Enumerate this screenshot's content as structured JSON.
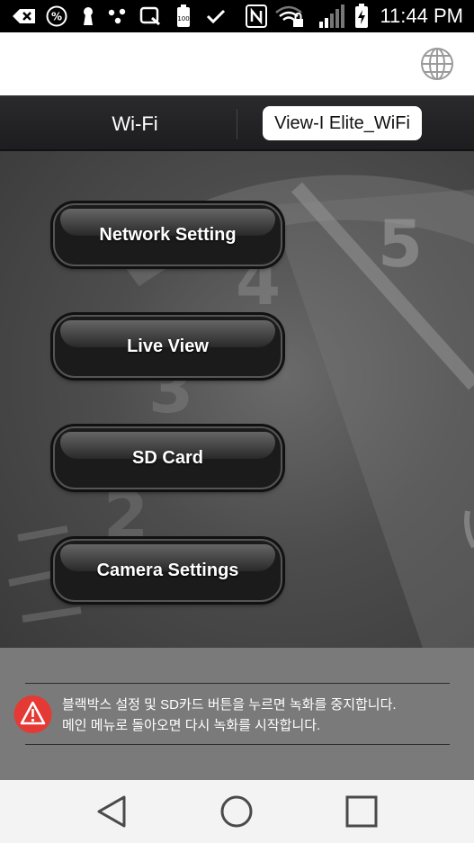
{
  "status_bar": {
    "time": "11:44 PM",
    "icons": [
      "back-icon",
      "percent-icon",
      "keyhole-icon",
      "share-icon",
      "q-icon",
      "battery-saver-icon",
      "check-icon",
      "nfc-icon",
      "wifi-lock-icon",
      "signal-icon",
      "battery-charging-icon"
    ]
  },
  "app_bar": {
    "icon": "globe-icon"
  },
  "wifi": {
    "label": "Wi-Fi",
    "ssid": "View-I Elite_WiFi"
  },
  "menu": [
    {
      "label": "Network Setting"
    },
    {
      "label": "Live View"
    },
    {
      "label": "SD Card"
    },
    {
      "label": "Camera Settings"
    }
  ],
  "notice": {
    "line1": "블랙박스 설정 및 SD카드 버튼을 누르면 녹화를 중지합니다.",
    "line2": "메인 메뉴로 돌아오면 다시 녹화를 시작합니다.",
    "icon": "warning-icon",
    "icon_color": "#e53935"
  },
  "nav_bar": {
    "icons": [
      "back-triangle-icon",
      "home-circle-icon",
      "recents-square-icon"
    ]
  }
}
